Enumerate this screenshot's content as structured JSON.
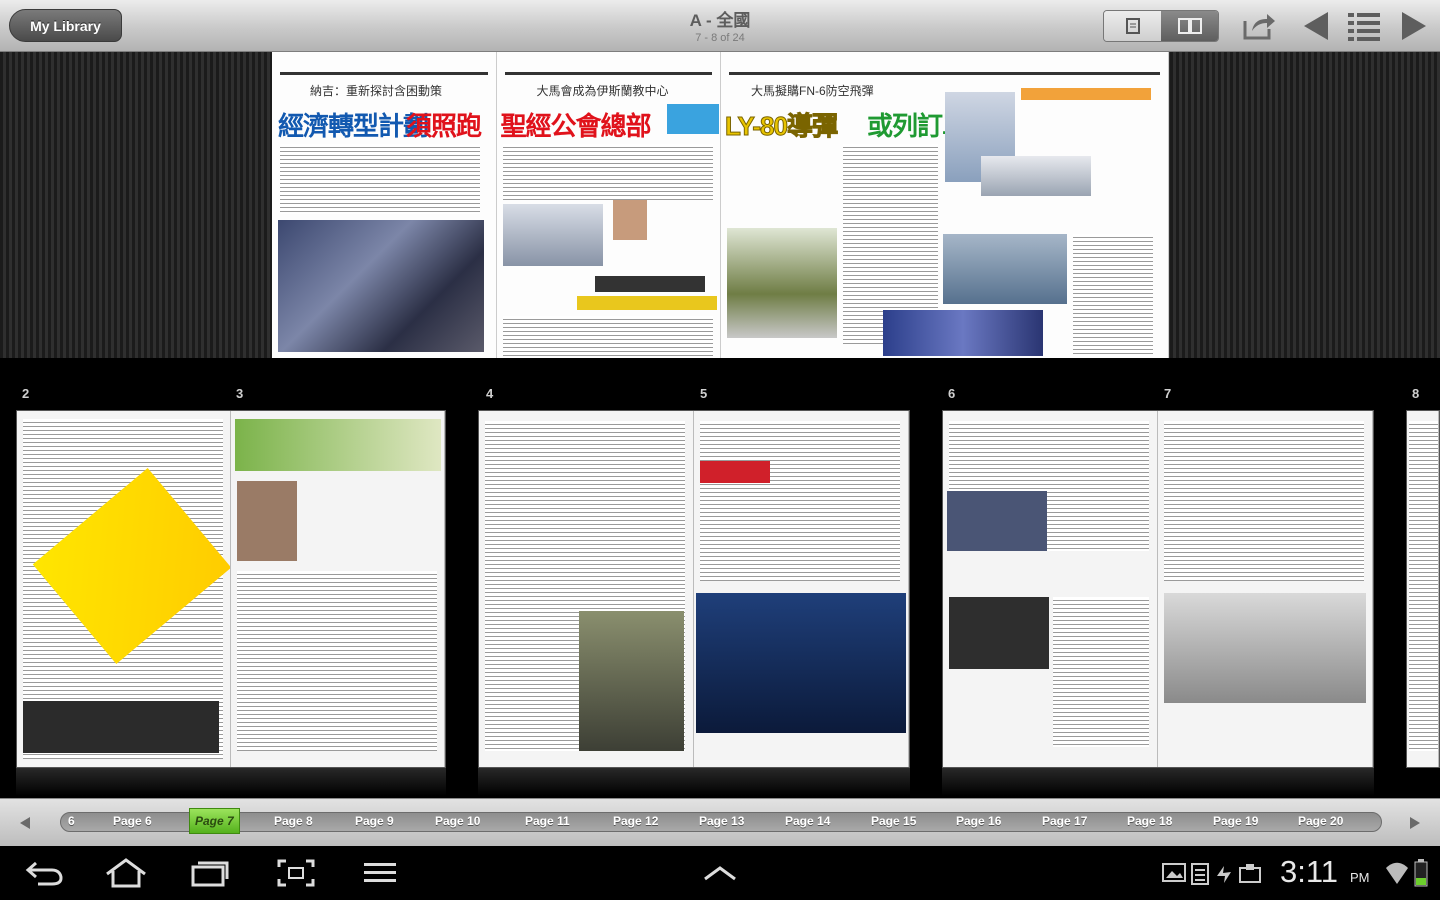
{
  "toolbar": {
    "library_label": "My Library",
    "title": "A - 全國",
    "subtitle": "7 - 8 of 24"
  },
  "main_spread": {
    "left_page": {
      "top_line": "納吉：重新探討含困動策",
      "headline_blue": "經濟轉型計劃",
      "headline_red": "須照跑"
    },
    "mid_page": {
      "top_line": "大馬會成為伊斯蘭教中心",
      "headline_red": "聖經公會總部"
    },
    "right_page": {
      "top_line": "大馬擬購FN-6防空飛彈",
      "headline_yellow": "LY-80導彈",
      "headline_green": "或列訂單"
    }
  },
  "thumbnails": [
    {
      "label_left": "2",
      "label_right": "3"
    },
    {
      "label_left": "4",
      "label_right": "5"
    },
    {
      "label_left": "6",
      "label_right": "7"
    },
    {
      "label_left": "8"
    }
  ],
  "scroller": {
    "pages": [
      "6",
      "Page 6",
      "Page 7",
      "Page 8",
      "Page 9",
      "Page 10",
      "Page 11",
      "Page 12",
      "Page 13",
      "Page 14",
      "Page 15",
      "Page 16",
      "Page 17",
      "Page 18",
      "Page 19",
      "Page 20"
    ],
    "active": "Page 7"
  },
  "status": {
    "time": "3:11",
    "ampm": "PM"
  },
  "colors": {
    "accent_green": "#6ccf2c",
    "headline_red": "#e0121b",
    "headline_blue": "#1259b0",
    "headline_green": "#1f9a32"
  }
}
